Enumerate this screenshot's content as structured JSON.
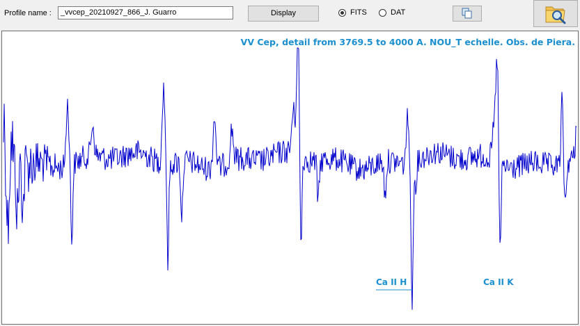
{
  "toolbar": {
    "profile_label": "Profile name :",
    "profile_value": "_vvcep_20210927_866_J. Guarro",
    "display_label": "Display",
    "radio_fits": "FITS",
    "radio_dat": "DAT",
    "fits_selected": true,
    "copy_icon": "copy-icon",
    "open_icon": "folder-search-icon"
  },
  "colors": {
    "spectrum": "#0000cc",
    "annotation": "#1a8fd0"
  },
  "plot": {
    "title": "VV Cep, detail from 3769.5 to 4000 A. NOU_T echelle. Obs. de Piera.",
    "annotations": [
      {
        "label": "Ca II H"
      },
      {
        "label": "Ca II K"
      }
    ]
  }
}
